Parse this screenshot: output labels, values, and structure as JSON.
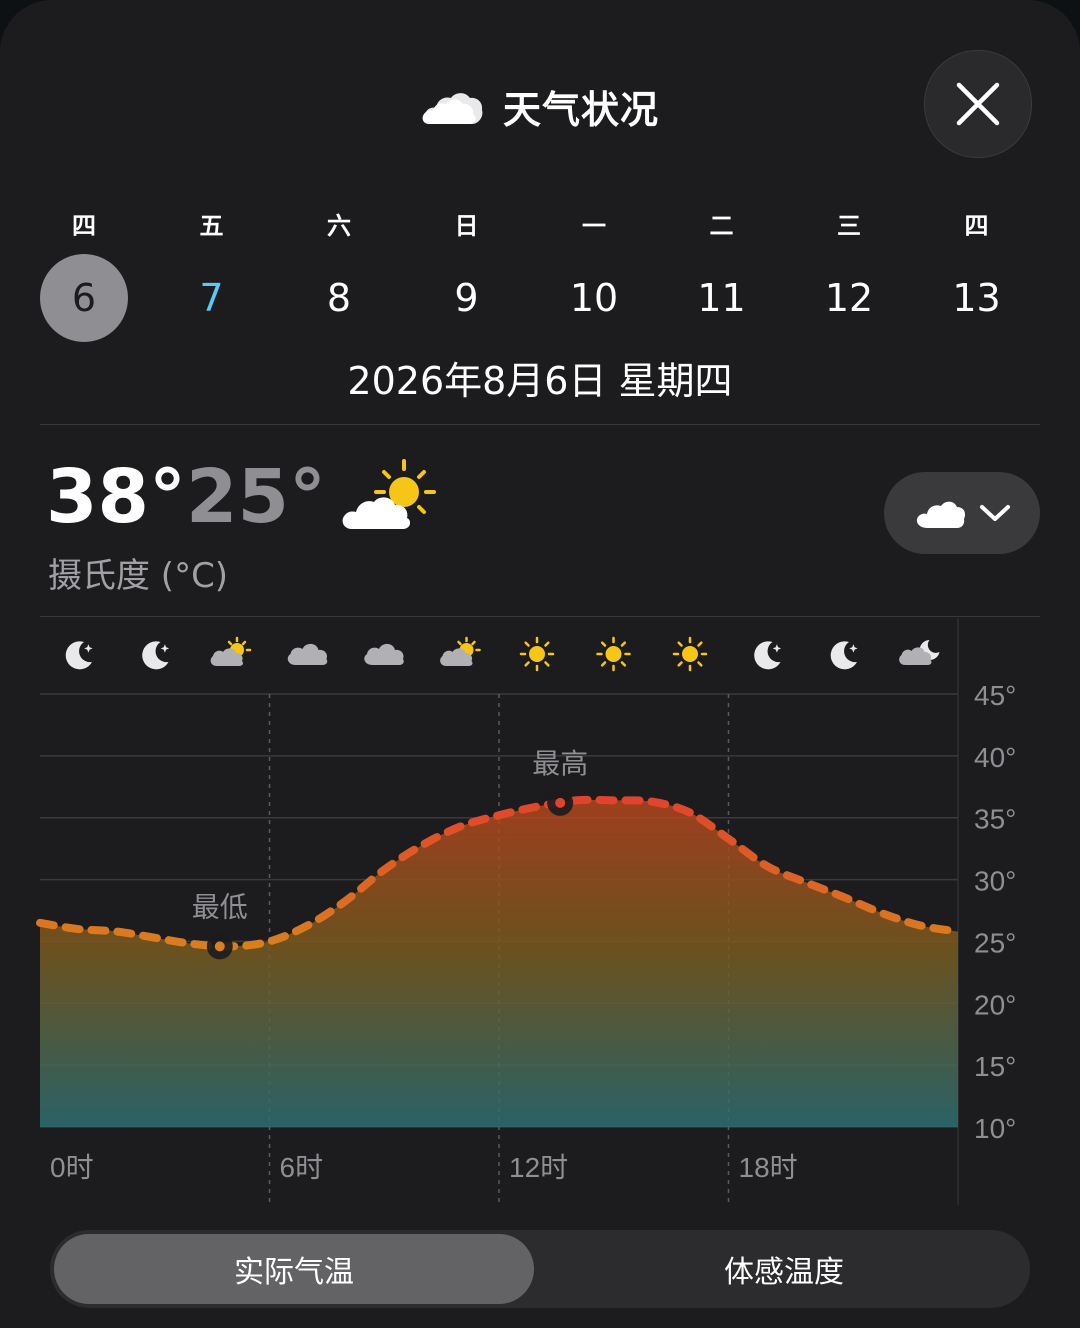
{
  "header": {
    "title": "天气状况",
    "icon": "cloud-icon"
  },
  "days": [
    {
      "dow": "四",
      "num": "6",
      "state": "selected"
    },
    {
      "dow": "五",
      "num": "7",
      "state": "today"
    },
    {
      "dow": "六",
      "num": "8",
      "state": ""
    },
    {
      "dow": "日",
      "num": "9",
      "state": ""
    },
    {
      "dow": "一",
      "num": "10",
      "state": ""
    },
    {
      "dow": "二",
      "num": "11",
      "state": ""
    },
    {
      "dow": "三",
      "num": "12",
      "state": ""
    },
    {
      "dow": "四",
      "num": "13",
      "state": ""
    }
  ],
  "date_full": "2026年8月6日 星期四",
  "summary": {
    "high": "38°",
    "low": "25°",
    "unit": "摄氏度 (°C)",
    "icon": "partly-sunny-icon"
  },
  "condition_selector": {
    "icon": "clouds-icon",
    "chevron": "chevron-down-icon"
  },
  "chart_data": {
    "type": "area",
    "x": [
      0,
      1,
      2,
      3,
      4,
      5,
      6,
      7,
      8,
      9,
      10,
      11,
      12,
      13,
      14,
      15,
      16,
      17,
      18,
      19,
      20,
      21,
      22,
      23,
      24
    ],
    "series": [
      {
        "values": [
          26.5,
          26.0,
          25.8,
          25.3,
          24.8,
          24.6,
          25.0,
          26.3,
          28.3,
          30.8,
          32.8,
          34.3,
          35.2,
          35.9,
          36.4,
          36.4,
          36.3,
          35.4,
          33.3,
          31.1,
          29.8,
          28.6,
          27.3,
          26.3,
          25.8
        ]
      }
    ],
    "hourly_icons": [
      "moon-star-icon",
      "moon-star-icon",
      "partly-sunny-icon",
      "cloud-icon",
      "cloud-icon",
      "partly-sunny-icon",
      "sun-icon",
      "sun-icon",
      "sun-icon",
      "moon-star-icon",
      "moon-star-icon",
      "cloud-moon-icon"
    ],
    "x_ticks": [
      0,
      6,
      12,
      18
    ],
    "x_tick_labels": [
      "0时",
      "6时",
      "12时",
      "18时"
    ],
    "y_ticks": [
      45,
      40,
      35,
      30,
      25,
      20,
      15,
      10
    ],
    "y_tick_labels": [
      "45°",
      "40°",
      "35°",
      "30°",
      "25°",
      "20°",
      "15°",
      "10°"
    ],
    "ylim": [
      10,
      45
    ],
    "annotations": [
      {
        "label": "最低",
        "x": 4.7,
        "y": 24.6
      },
      {
        "label": "最高",
        "x": 13.6,
        "y": 36.2
      }
    ],
    "colors": {
      "line": "#d97f1f",
      "gradient_top": "#b5451d",
      "gradient_mid": "#7a5a1e",
      "gradient_bottom": "#2c6e72"
    },
    "grid": true
  },
  "segmented": {
    "options": [
      "实际气温",
      "体感温度"
    ],
    "active": 0
  }
}
